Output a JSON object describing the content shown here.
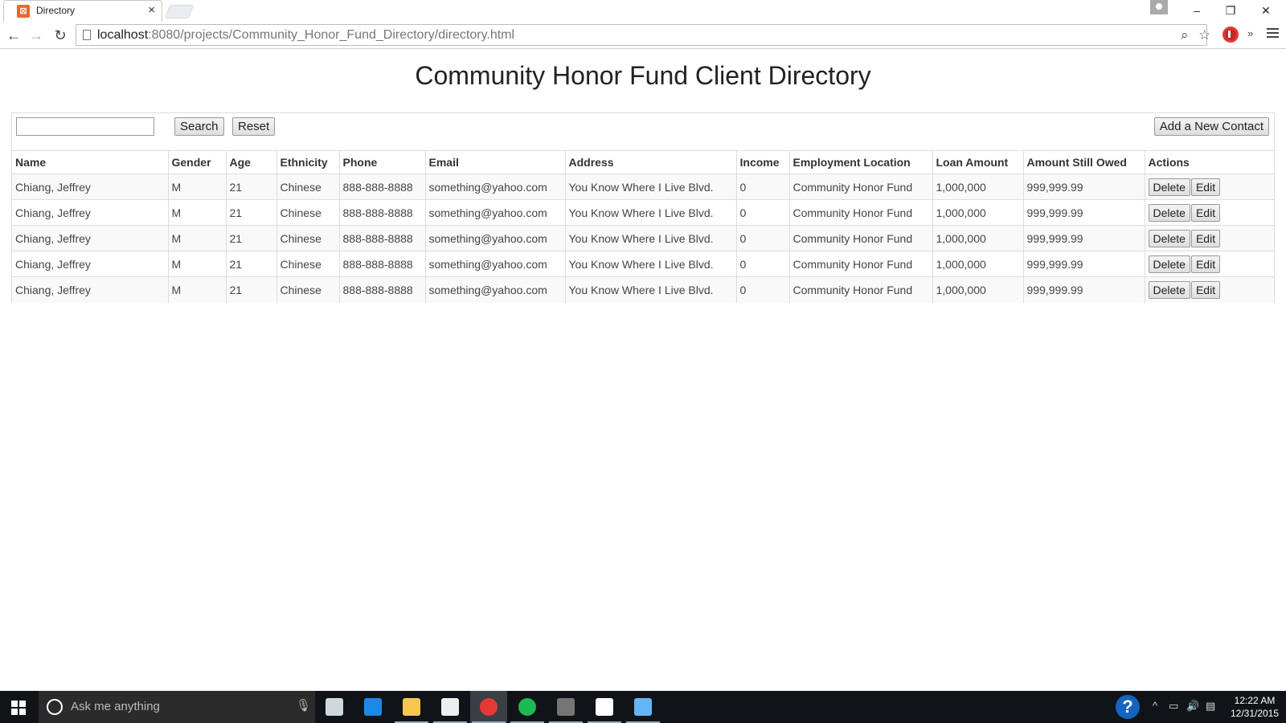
{
  "browser": {
    "tab_title": "Directory",
    "tab_close": "×",
    "url_host": "localhost",
    "url_path": ":8080/projects/Community_Honor_Fund_Directory/directory.html",
    "window_controls": {
      "minimize": "–",
      "maximize": "❐",
      "close": "✕"
    }
  },
  "page": {
    "title": "Community Honor Fund Client Directory"
  },
  "controls": {
    "search_value": "",
    "search_label": "Search",
    "reset_label": "Reset",
    "add_label": "Add a New Contact"
  },
  "table": {
    "headers": [
      "Name",
      "Gender",
      "Age",
      "Ethnicity",
      "Phone",
      "Email",
      "Address",
      "Income",
      "Employment Location",
      "Loan Amount",
      "Amount Still Owed",
      "Actions"
    ],
    "delete_label": "Delete",
    "edit_label": "Edit",
    "rows": [
      [
        "Chiang, Jeffrey",
        "M",
        "21",
        "Chinese",
        "888-888-8888",
        "something@yahoo.com",
        "You Know Where I Live Blvd.",
        "0",
        "Community Honor Fund",
        "1,000,000",
        "999,999.99"
      ],
      [
        "Chiang, Jeffrey",
        "M",
        "21",
        "Chinese",
        "888-888-8888",
        "something@yahoo.com",
        "You Know Where I Live Blvd.",
        "0",
        "Community Honor Fund",
        "1,000,000",
        "999,999.99"
      ],
      [
        "Chiang, Jeffrey",
        "M",
        "21",
        "Chinese",
        "888-888-8888",
        "something@yahoo.com",
        "You Know Where I Live Blvd.",
        "0",
        "Community Honor Fund",
        "1,000,000",
        "999,999.99"
      ],
      [
        "Chiang, Jeffrey",
        "M",
        "21",
        "Chinese",
        "888-888-8888",
        "something@yahoo.com",
        "You Know Where I Live Blvd.",
        "0",
        "Community Honor Fund",
        "1,000,000",
        "999,999.99"
      ],
      [
        "Chiang, Jeffrey",
        "M",
        "21",
        "Chinese",
        "888-888-8888",
        "something@yahoo.com",
        "You Know Where I Live Blvd.",
        "0",
        "Community Honor Fund",
        "1,000,000",
        "999,999.99"
      ]
    ]
  },
  "taskbar": {
    "search_placeholder": "Ask me anything",
    "help_label": "?",
    "time": "12:22 AM",
    "date": "12/31/2015",
    "apps": [
      {
        "name": "task-view",
        "color": "#cfd8dc"
      },
      {
        "name": "edge",
        "color": "#1e88e5"
      },
      {
        "name": "file-explorer",
        "color": "#f9c74f"
      },
      {
        "name": "store",
        "color": "#eeeeee"
      },
      {
        "name": "chrome",
        "color": "#e53935"
      },
      {
        "name": "spotify",
        "color": "#1db954"
      },
      {
        "name": "sublime-text",
        "color": "#757575"
      },
      {
        "name": "photos",
        "color": "#ffffff"
      },
      {
        "name": "paint",
        "color": "#64b5f6"
      }
    ]
  }
}
